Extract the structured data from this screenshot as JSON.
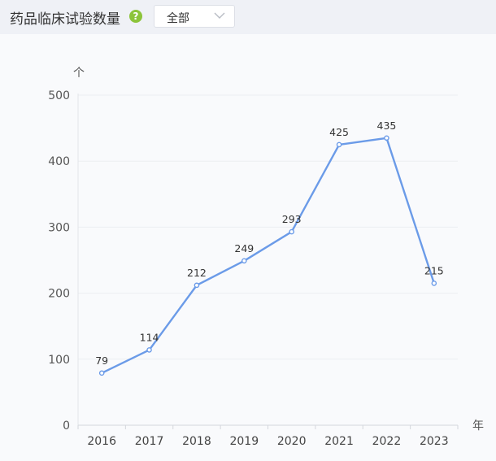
{
  "header": {
    "title": "药品临床试验数量",
    "help_icon": "question-circle-icon",
    "help_glyph": "?",
    "filter": {
      "selected": "全部",
      "icon": "chevron-down-icon"
    }
  },
  "colors": {
    "line": "#6b9be8",
    "help": "#8cc43a",
    "grid": "#eceef2"
  },
  "chart_data": {
    "type": "line",
    "title": "药品临床试验数量",
    "xunit": "年",
    "yunit": "个",
    "categories": [
      "2016",
      "2017",
      "2018",
      "2019",
      "2020",
      "2021",
      "2022",
      "2023"
    ],
    "series": [
      {
        "values": [
          79,
          114,
          212,
          249,
          293,
          425,
          435,
          215
        ]
      }
    ],
    "ylim": [
      0,
      500
    ],
    "yticks": [
      0,
      100,
      200,
      300,
      400,
      500
    ],
    "data_labels": true,
    "grid": true
  }
}
